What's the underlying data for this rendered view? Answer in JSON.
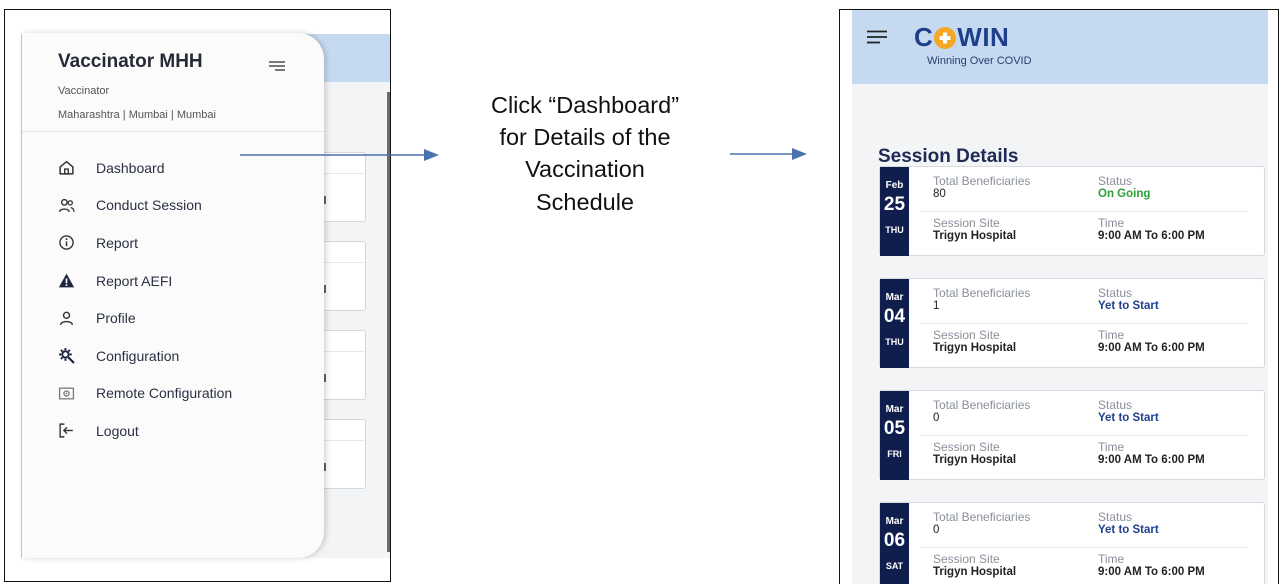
{
  "left_app": {
    "drawer": {
      "user_name": "Vaccinator MHH",
      "role": "Vaccinator",
      "location": "Maharashtra | Mumbai | Mumbai",
      "items": [
        {
          "label": "Dashboard",
          "icon": "home-icon"
        },
        {
          "label": "Conduct Session",
          "icon": "users-icon"
        },
        {
          "label": "Report",
          "icon": "info-icon"
        },
        {
          "label": "Report AEFI",
          "icon": "warning-icon"
        },
        {
          "label": "Profile",
          "icon": "user-icon"
        },
        {
          "label": "Configuration",
          "icon": "gear-icon"
        },
        {
          "label": "Remote Configuration",
          "icon": "remote-config-icon"
        },
        {
          "label": "Logout",
          "icon": "logout-icon"
        }
      ]
    }
  },
  "caption": {
    "line1": "Click “Dashboard”",
    "line2": "for Details of the",
    "line3": "Vaccination",
    "line4": "Schedule"
  },
  "right_app": {
    "logo": {
      "prefix": "C",
      "suffix": "WIN",
      "tagline": "Winning Over COVID"
    },
    "title": "Session Details",
    "labels": {
      "beneficiaries": "Total Beneficiaries",
      "status": "Status",
      "site": "Session Site",
      "time": "Time"
    },
    "colors": {
      "date_block": "#0f1e4d",
      "status_ongoing": "#2e9e3a",
      "status_upcoming": "#1f3f8f",
      "header": "#c5daf0",
      "logo_accent": "#f5a623"
    },
    "sessions": [
      {
        "month": "Feb",
        "day": "25",
        "weekday": "THU",
        "beneficiaries": "80",
        "status": "On Going",
        "site": "Trigyn Hospital",
        "time": "9:00 AM To 6:00 PM"
      },
      {
        "month": "Mar",
        "day": "04",
        "weekday": "THU",
        "beneficiaries": "1",
        "status": "Yet to Start",
        "site": "Trigyn Hospital",
        "time": "9:00 AM To 6:00 PM"
      },
      {
        "month": "Mar",
        "day": "05",
        "weekday": "FRI",
        "beneficiaries": "0",
        "status": "Yet to Start",
        "site": "Trigyn Hospital",
        "time": "9:00 AM To 6:00 PM"
      },
      {
        "month": "Mar",
        "day": "06",
        "weekday": "SAT",
        "beneficiaries": "0",
        "status": "Yet to Start",
        "site": "Trigyn Hospital",
        "time": "9:00 AM To 6:00 PM"
      }
    ]
  }
}
